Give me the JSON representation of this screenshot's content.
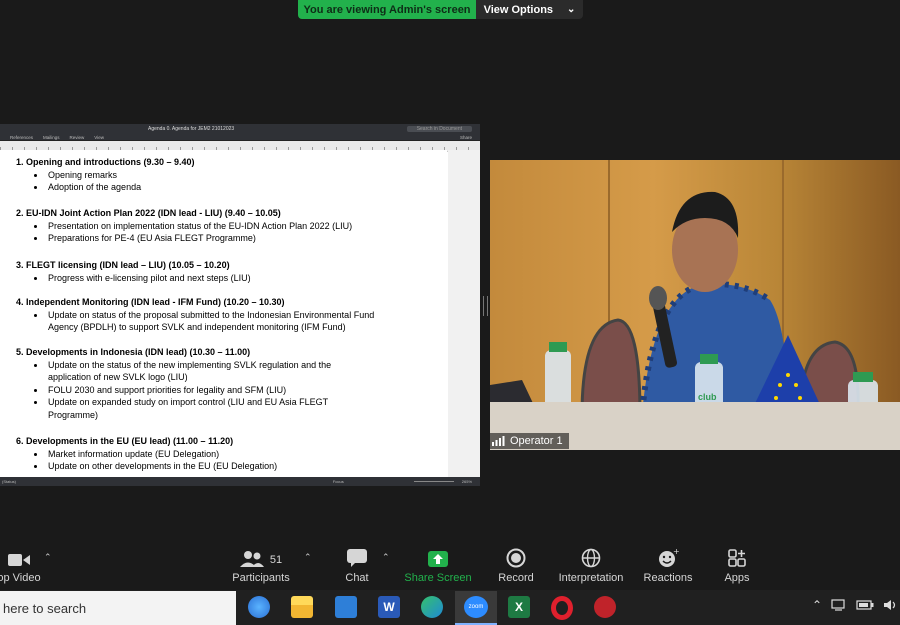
{
  "banner": {
    "message": "You are viewing Admin's screen",
    "options_label": "View Options",
    "options_chevron": "⌄"
  },
  "word": {
    "title": "Agenda 0. Agenda for JEM2 21012023",
    "search_placeholder": "Search in Document",
    "ribbon_tabs": [
      "References",
      "Mailings",
      "Review",
      "View"
    ],
    "share_label": "Share",
    "status_left": "(Status)",
    "status_focus": "Focus",
    "zoom_percent": "265%",
    "agenda": [
      {
        "heading": "1.   Opening and introductions (9.30 – 9.40)",
        "bullets": [
          "Opening remarks",
          "Adoption of the agenda"
        ]
      },
      {
        "heading": "2.   EU-IDN Joint Action Plan 2022 (IDN lead - LIU) (9.40 – 10.05)",
        "bullets": [
          "Presentation on implementation status of the EU-IDN Action Plan 2022 (LIU)",
          "Preparations for PE-4 (EU Asia FLEGT Programme)"
        ]
      },
      {
        "heading": "3.   FLEGT licensing (IDN lead – LIU) (10.05 – 10.20)",
        "bullets": [
          "Progress with e-licensing pilot and next steps (LIU)"
        ]
      },
      {
        "heading": "4.   Independent Monitoring (IDN lead - IFM Fund) (10.20 – 10.30)",
        "bullets": [
          "Update on status of the proposal submitted to the Indonesian Environmental Fund Agency (BPDLH) to support SVLK and independent monitoring (IFM Fund)"
        ]
      },
      {
        "heading": "5.   Developments in Indonesia (IDN lead) (10.30 – 11.00)",
        "bullets": [
          "Update on the status of the new implementing SVLK regulation and the application of new SVLK logo (LIU)",
          "FOLU 2030 and support priorities for legality and SFM (LIU)",
          "Update on expanded study on import control (LIU and EU Asia FLEGT Programme)"
        ]
      },
      {
        "heading": "6.   Developments in the EU (EU lead) (11.00 – 11.20)",
        "bullets": [
          "Market information update (EU Delegation)",
          "Update on other developments in the EU (EU Delegation)"
        ]
      }
    ]
  },
  "video": {
    "participant_name": "Operator 1",
    "bottle_label": "club"
  },
  "toolbar": {
    "items": [
      {
        "label": "op Video",
        "icon": "video-camera-icon"
      },
      {
        "label": "Participants",
        "icon": "participants-icon",
        "count": "51"
      },
      {
        "label": "Chat",
        "icon": "chat-icon"
      },
      {
        "label": "Share Screen",
        "icon": "share-screen-icon"
      },
      {
        "label": "Record",
        "icon": "record-icon"
      },
      {
        "label": "Interpretation",
        "icon": "globe-icon"
      },
      {
        "label": "Reactions",
        "icon": "reactions-icon"
      },
      {
        "label": "Apps",
        "icon": "apps-icon"
      }
    ],
    "accent": "#22b14c"
  },
  "taskbar": {
    "search_placeholder": "here to search",
    "zoom_label": "zoom"
  }
}
